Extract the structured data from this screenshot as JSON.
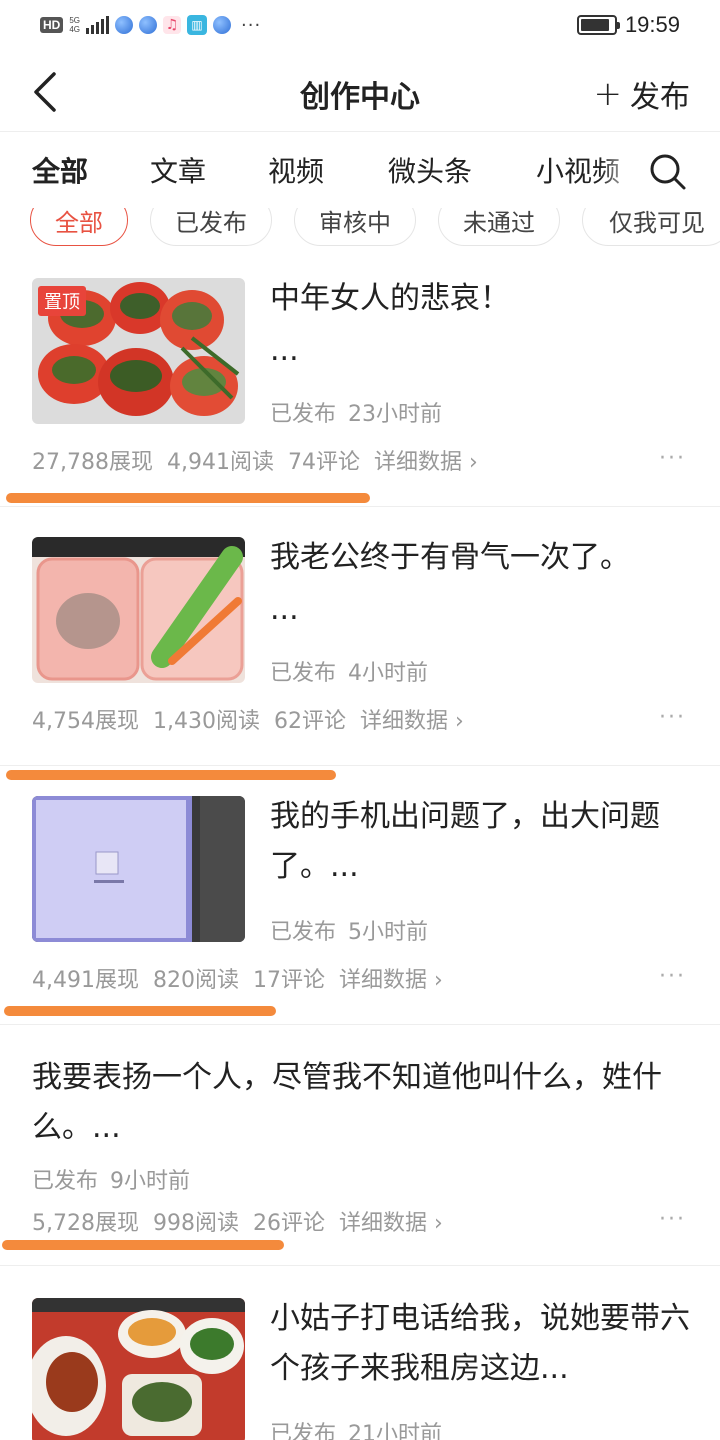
{
  "status_bar": {
    "hd": "HD",
    "network": "5G",
    "network_sub": "4G",
    "more": "···",
    "time": "19:59"
  },
  "header": {
    "title": "创作中心",
    "publish_label": "发布"
  },
  "tabs": [
    "全部",
    "文章",
    "视频",
    "微头条",
    "小视频"
  ],
  "filters": [
    "全部",
    "已发布",
    "审核中",
    "未通过",
    "仅我可见"
  ],
  "articles": [
    {
      "pinned_label": "置顶",
      "title": "中年女人的悲哀！",
      "ellipsis": "...",
      "status": "已发布",
      "time": "23小时前",
      "impressions": "27,788展现",
      "reads": "4,941阅读",
      "comments": "74评论",
      "details": "详细数据 ›"
    },
    {
      "title": "我老公终于有骨气一次了。",
      "ellipsis": "...",
      "status": "已发布",
      "time": "4小时前",
      "impressions": "4,754展现",
      "reads": "1,430阅读",
      "comments": "62评论",
      "details": "详细数据 ›"
    },
    {
      "title": "我的手机出问题了，出大问题了。...",
      "status": "已发布",
      "time": "5小时前",
      "impressions": "4,491展现",
      "reads": "820阅读",
      "comments": "17评论",
      "details": "详细数据 ›"
    },
    {
      "title": "我要表扬一个人，尽管我不知道他叫什么，姓什么。...",
      "status": "已发布",
      "time": "9小时前",
      "impressions": "5,728展现",
      "reads": "998阅读",
      "comments": "26评论",
      "details": "详细数据 ›"
    },
    {
      "title": "小姑子打电话给我，说她要带六个孩子来我租房这边...",
      "status": "已发布",
      "time": "21小时前"
    }
  ],
  "more_icon": "···",
  "colors": {
    "accent": "#e85242",
    "annotation_underline": "#f48a3c",
    "muted_text": "#999999"
  }
}
